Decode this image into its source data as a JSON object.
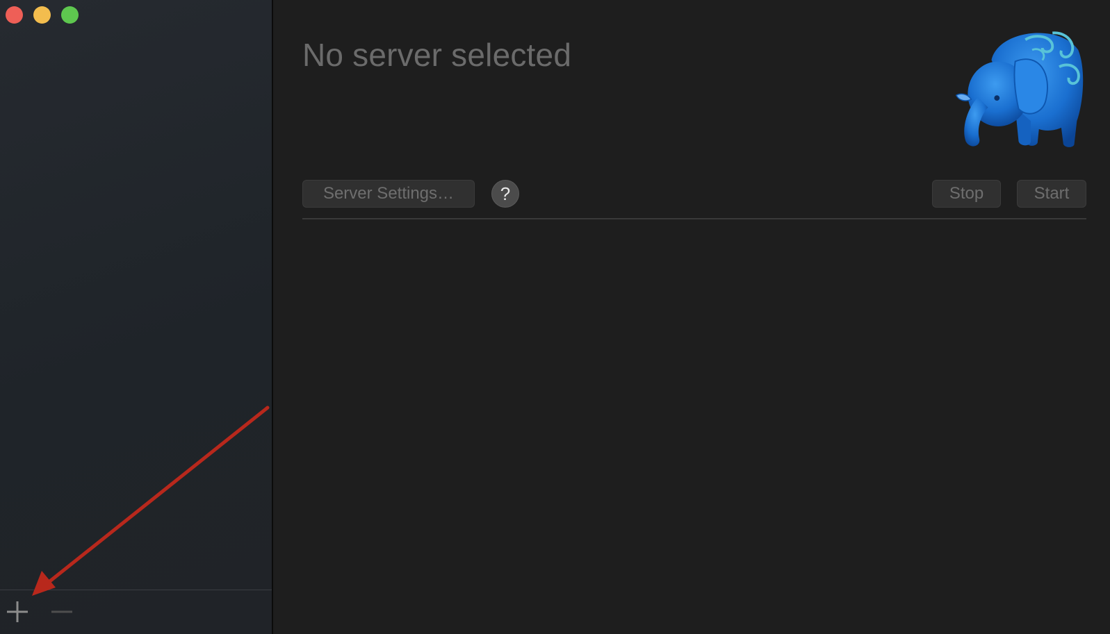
{
  "window": {
    "traffic_lights": {
      "close": {
        "icon": "close-icon",
        "color": "#ee5f57"
      },
      "minimize": {
        "icon": "minimize-icon",
        "color": "#f3bd4e"
      },
      "maximize": {
        "icon": "maximize-icon",
        "color": "#5ec74f"
      }
    }
  },
  "sidebar": {
    "footer": {
      "add_icon": "plus-icon",
      "remove_icon": "minus-icon"
    }
  },
  "main": {
    "title": "No server selected",
    "logo_icon": "elephant-logo",
    "toolbar": {
      "server_settings_label": "Server Settings…",
      "help_label": "?",
      "stop_label": "Stop",
      "start_label": "Start"
    }
  },
  "annotation": {
    "type": "arrow",
    "color": "#b8281c",
    "points_to": "plus-icon"
  }
}
